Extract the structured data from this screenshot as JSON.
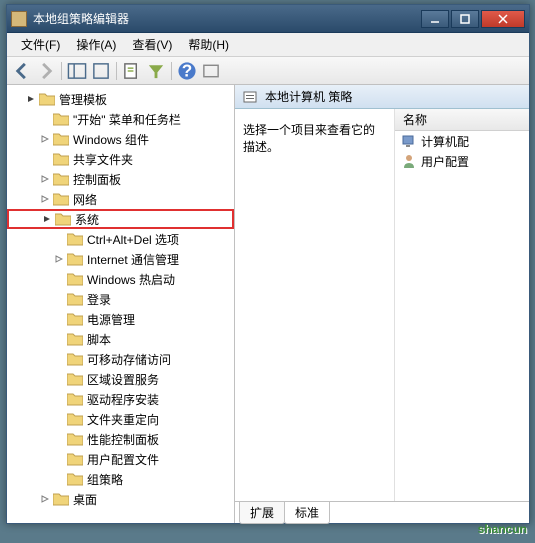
{
  "window": {
    "title": "本地组策略编辑器"
  },
  "menu": {
    "file": "文件(F)",
    "action": "操作(A)",
    "view": "查看(V)",
    "help": "帮助(H)"
  },
  "tree": {
    "root": "管理模板",
    "items": {
      "start_menu": "\"开始\" 菜单和任务栏",
      "windows_comp": "Windows 组件",
      "shared_folders": "共享文件夹",
      "control_panel": "控制面板",
      "network": "网络",
      "system": "系统",
      "ctrl_alt_del": "Ctrl+Alt+Del 选项",
      "internet_comm": "Internet 通信管理",
      "windows_hotstart": "Windows 热启动",
      "logon": "登录",
      "power_mgmt": "电源管理",
      "scripts": "脚本",
      "removable": "可移动存储访问",
      "locale": "区域设置服务",
      "driver_install": "驱动程序安装",
      "folder_redirect": "文件夹重定向",
      "perf_panel": "性能控制面板",
      "user_config_files": "用户配置文件",
      "group_policy": "组策略",
      "desktop": "桌面"
    }
  },
  "right": {
    "header": "本地计算机 策略",
    "desc": "选择一个项目来查看它的描述。",
    "col_name": "名称",
    "item1": "计算机配",
    "item2": "用户配置"
  },
  "tabs": {
    "extended": "扩展",
    "standard": "标准"
  },
  "watermark": "shancun"
}
